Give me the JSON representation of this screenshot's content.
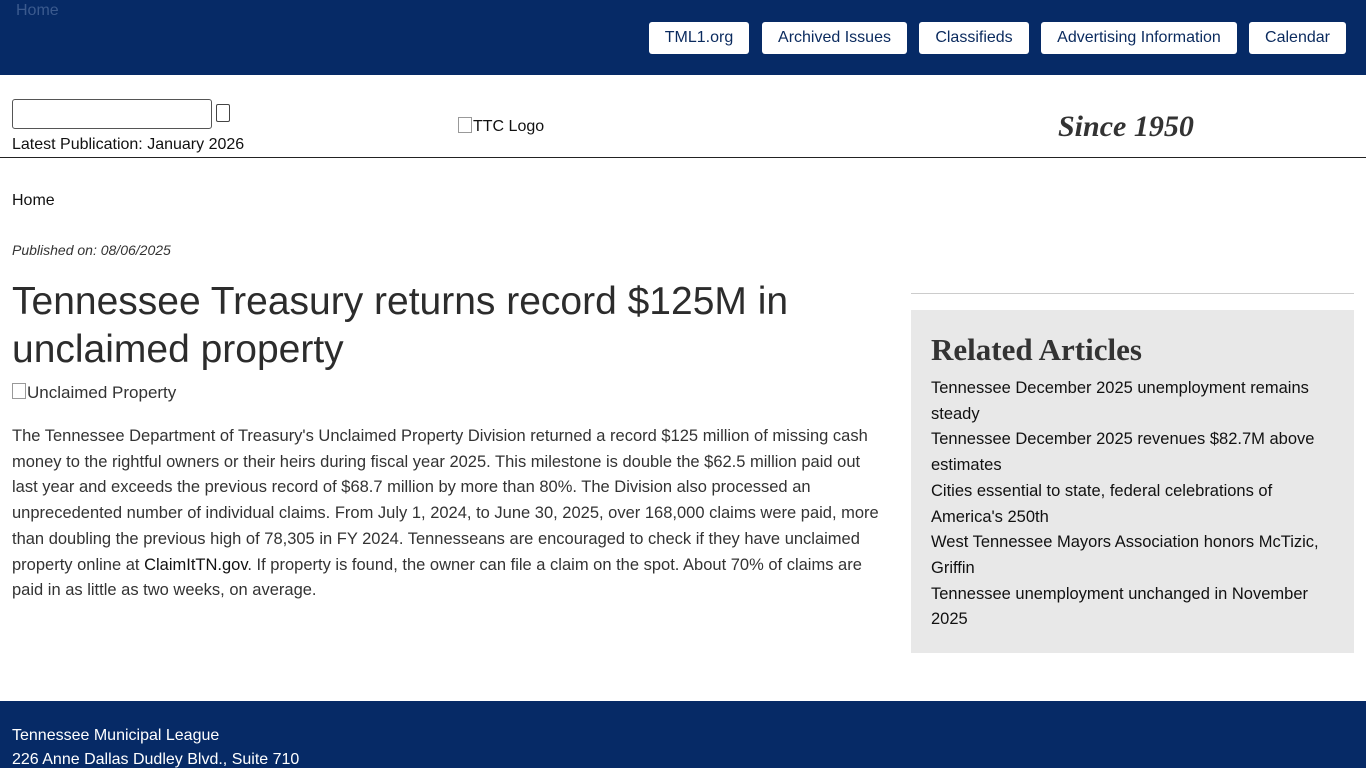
{
  "topbar": {
    "home_image_alt": "Home",
    "nav": [
      {
        "label": "TML1.org"
      },
      {
        "label": "Archived Issues"
      },
      {
        "label": "Classifieds"
      },
      {
        "label": "Advertising Information"
      },
      {
        "label": "Calendar"
      }
    ]
  },
  "header": {
    "search": {
      "value": "",
      "placeholder": ""
    },
    "latest_publication": "Latest Publication: January 2026",
    "logo_alt": "TTC Logo",
    "tagline": "Since 1950"
  },
  "breadcrumb": {
    "home": "Home"
  },
  "article": {
    "published": "Published on: 08/06/2025",
    "title": "Tennessee Treasury returns record $125M in unclaimed property",
    "image_alt": "Unclaimed Property",
    "body_before_link": "The Tennessee Department of Treasury's Unclaimed Property Division returned a record $125 million of missing cash money to the rightful owners or their heirs during fiscal year 2025. This milestone is double the $62.5 million paid out last year and exceeds the previous record of $68.7 million by more than 80%. The Division also processed an unprecedented number of individual claims. From July 1, 2024, to June 30, 2025, over 168,000 claims were paid, more than doubling the previous high of 78,305 in FY 2024. Tennesseans are encouraged to check if they have unclaimed property online at ",
    "link": "ClaimItTN.gov",
    "body_after_link": ". If property is found, the owner can file a claim on the spot. About 70% of claims are paid in as little as two weeks, on average."
  },
  "sidebar": {
    "title": "Related Articles",
    "items": [
      {
        "label": "Tennessee December 2025 unemployment remains steady"
      },
      {
        "label": "Tennessee December 2025 revenues $82.7M above estimates"
      },
      {
        "label": "Cities essential to state, federal celebrations of America's 250th"
      },
      {
        "label": "West Tennessee Mayors Association honors McTizic, Griffin"
      },
      {
        "label": "Tennessee unemployment unchanged in November 2025"
      }
    ]
  },
  "footer": {
    "org": "Tennessee Municipal League",
    "address": "226 Anne Dallas Dudley Blvd., Suite 710"
  },
  "colors": {
    "brand_navy": "#062a66",
    "sidebar_bg": "#e8e8e8"
  }
}
